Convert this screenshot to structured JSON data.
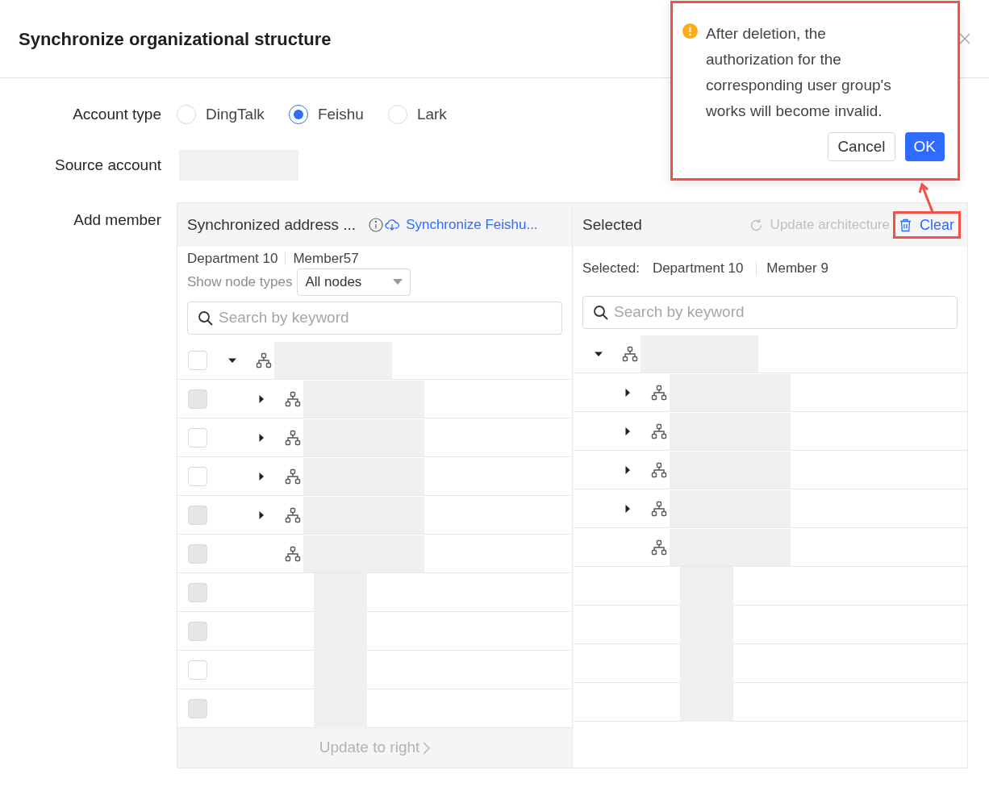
{
  "dialog": {
    "title": "Synchronize organizational structure"
  },
  "form": {
    "account_type": {
      "label": "Account type",
      "options": [
        {
          "label": "DingTalk",
          "selected": false
        },
        {
          "label": "Feishu",
          "selected": true
        },
        {
          "label": "Lark",
          "selected": false
        }
      ]
    },
    "source_account": {
      "label": "Source account"
    },
    "add_member": {
      "label": "Add member"
    }
  },
  "left_panel": {
    "title": "Synchronized address ...",
    "sync_link": "Synchronize Feishu...",
    "counts": [
      "Department 10",
      "Member57"
    ],
    "node_type_label": "Show node types",
    "node_type_value": "All nodes",
    "search_placeholder": "Search by keyword",
    "tree": [
      {
        "kind": "department",
        "expanded": true,
        "disabled": false,
        "children": [
          {
            "kind": "department",
            "expanded": false,
            "disabled": true
          },
          {
            "kind": "department",
            "expanded": false,
            "disabled": false
          },
          {
            "kind": "department",
            "expanded": false,
            "disabled": false
          },
          {
            "kind": "department",
            "expanded": false,
            "disabled": true
          },
          {
            "kind": "leaf",
            "disabled": true
          },
          {
            "kind": "member",
            "disabled": true
          },
          {
            "kind": "member",
            "disabled": true
          },
          {
            "kind": "member",
            "disabled": false
          },
          {
            "kind": "member",
            "disabled": true
          }
        ]
      }
    ],
    "footer_button": {
      "label": "Update to right",
      "disabled": true
    }
  },
  "right_panel": {
    "title": "Selected",
    "update_button": {
      "label": "Update architecture",
      "disabled": true
    },
    "clear_button": "Clear",
    "counts_label": "Selected:",
    "counts": [
      "Department 10",
      "Member 9"
    ],
    "search_placeholder": "Search by keyword",
    "tree": [
      {
        "kind": "department",
        "expanded": true,
        "children": [
          {
            "kind": "department",
            "expanded": false
          },
          {
            "kind": "department",
            "expanded": false
          },
          {
            "kind": "department",
            "expanded": false
          },
          {
            "kind": "department",
            "expanded": false
          },
          {
            "kind": "leaf"
          },
          {
            "kind": "member"
          },
          {
            "kind": "member"
          },
          {
            "kind": "member"
          },
          {
            "kind": "member"
          }
        ]
      }
    ]
  },
  "popconfirm": {
    "message": "After deletion, the authorization for the corresponding user group's works will become invalid.",
    "buttons": [
      {
        "label": "Cancel",
        "kind": "default"
      },
      {
        "label": "OK",
        "kind": "primary"
      }
    ]
  }
}
